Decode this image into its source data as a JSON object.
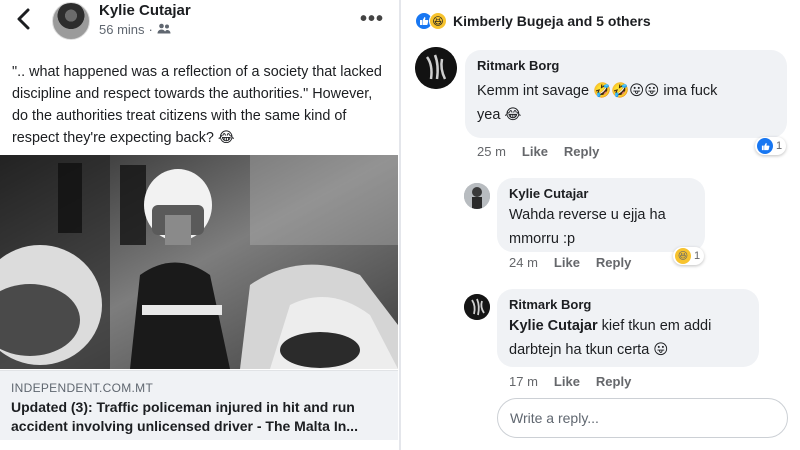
{
  "post": {
    "author": "Kylie Cutajar",
    "time": "56 mins",
    "text": "\".. what happened was a reflection of a society that lacked discipline and respect towards the authorities.\" However, do the authorities treat citizens with the same kind of respect they're expecting back? 😂",
    "link_domain": "INDEPENDENT.COM.MT",
    "link_title": "Updated (3): Traffic policeman injured in hit and run accident involving unlicensed driver - The Malta In..."
  },
  "reactions": {
    "summary": "Kimberly Bugeja and 5 others",
    "icons": [
      "like-icon",
      "haha-icon"
    ]
  },
  "comments": [
    {
      "author": "Ritmark Borg",
      "text_line1": "Kemm int savage 🤣🤣😛😛 ima fuck",
      "text_line2": "yea 😂",
      "time": "25 m",
      "like_label": "Like",
      "reply_label": "Reply",
      "reaction_count": "1"
    },
    {
      "author": "Kylie Cutajar",
      "text_line1": "Wahda reverse u ejja ha",
      "text_line2": "mmorru :p",
      "time": "24 m",
      "like_label": "Like",
      "reply_label": "Reply",
      "reaction_count": "1"
    },
    {
      "author": "Ritmark Borg",
      "mention": "Kylie Cutajar",
      "text_line1_rest": " kief tkun em addi",
      "text_line2": "darbtejn ha tkun  certa 😛",
      "time": "17 m",
      "like_label": "Like",
      "reply_label": "Reply"
    }
  ],
  "reply_box": {
    "placeholder": "Write a reply..."
  },
  "colors": {
    "accent": "#1877f2",
    "bubble": "#f0f2f5",
    "meta": "#65676b"
  }
}
